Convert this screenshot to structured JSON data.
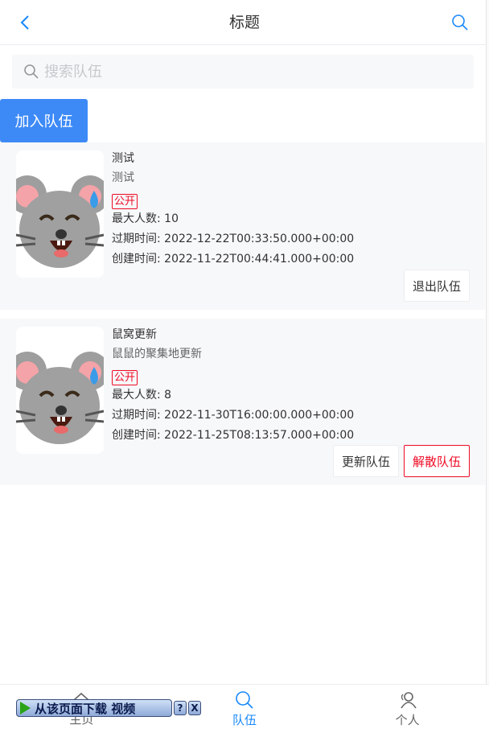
{
  "navbar": {
    "title": "标题",
    "back_icon": "chevron-left-icon",
    "search_icon": "search-icon"
  },
  "search": {
    "placeholder": "搜索队伍",
    "value": ""
  },
  "join_button": "加入队伍",
  "teams": [
    {
      "name": "测试",
      "description": "测试",
      "status": "公开",
      "max_members": "最大人数: 10",
      "expire_time": "过期时间: 2022-12-22T00:33:50.000+00:00",
      "create_time": "创建时间: 2022-11-22T00:44:41.000+00:00",
      "actions": [
        "退出队伍"
      ]
    },
    {
      "name": "鼠窝更新",
      "description": "鼠鼠的聚集地更新",
      "status": "公开",
      "max_members": "最大人数: 8",
      "expire_time": "过期时间: 2022-11-30T16:00:00.000+00:00",
      "create_time": "创建时间: 2022-11-25T08:13:57.000+00:00",
      "actions": [
        "更新队伍",
        "解散队伍"
      ]
    }
  ],
  "tabbar": [
    {
      "label": "主页",
      "icon": "home-icon",
      "active": false
    },
    {
      "label": "队伍",
      "icon": "search-icon",
      "active": true
    },
    {
      "label": "个人",
      "icon": "user-icon",
      "active": false
    }
  ],
  "download_banner": {
    "label": "从该页面下载 视频",
    "help": "?",
    "close": "X"
  },
  "colors": {
    "primary": "#3d8af7",
    "tab_active": "#1989fa",
    "danger": "#ee0a24",
    "card_bg": "#f7f8fa"
  }
}
